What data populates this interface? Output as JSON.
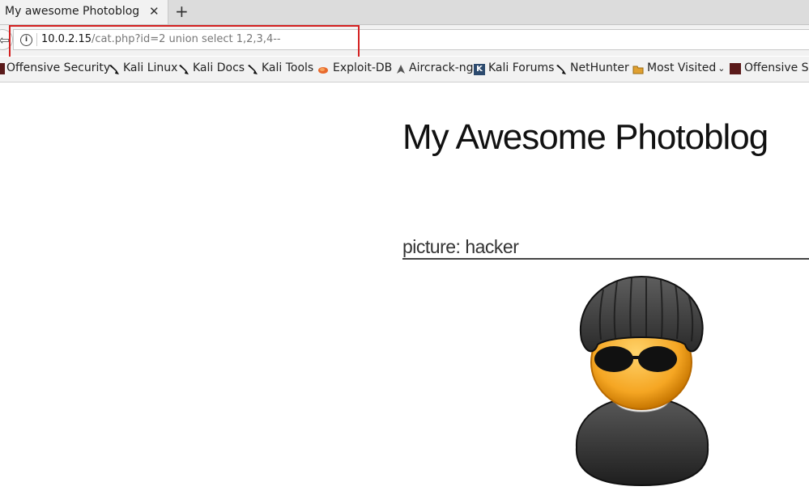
{
  "tab": {
    "title": "My awesome Photoblog",
    "close_icon": "close-icon",
    "new_tab_icon": "plus-icon"
  },
  "nav": {
    "url_host": "10.0.2.15",
    "url_path": "/cat.php?id=2 union select 1,2,3,4--"
  },
  "bookmarks": [
    {
      "label": "Offensive Security",
      "icon": "offsec-icon"
    },
    {
      "label": "Kali Linux",
      "icon": "kali-dragon-icon"
    },
    {
      "label": "Kali Docs",
      "icon": "kali-dragon-icon"
    },
    {
      "label": "Kali Tools",
      "icon": "kali-dragon-icon"
    },
    {
      "label": "Exploit-DB",
      "icon": "exploitdb-icon"
    },
    {
      "label": "Aircrack-ng",
      "icon": "aircrack-icon"
    },
    {
      "label": "Kali Forums",
      "icon": "kali-forums-icon"
    },
    {
      "label": "NetHunter",
      "icon": "kali-dragon-icon"
    },
    {
      "label": "Most Visited",
      "icon": "folder-icon"
    },
    {
      "label": "Offensive Se",
      "icon": "offsec-icon"
    }
  ],
  "page": {
    "heading": "My Awesome Photoblog",
    "picture_caption": "picture: hacker"
  },
  "colors": {
    "highlight": "#d42020"
  }
}
